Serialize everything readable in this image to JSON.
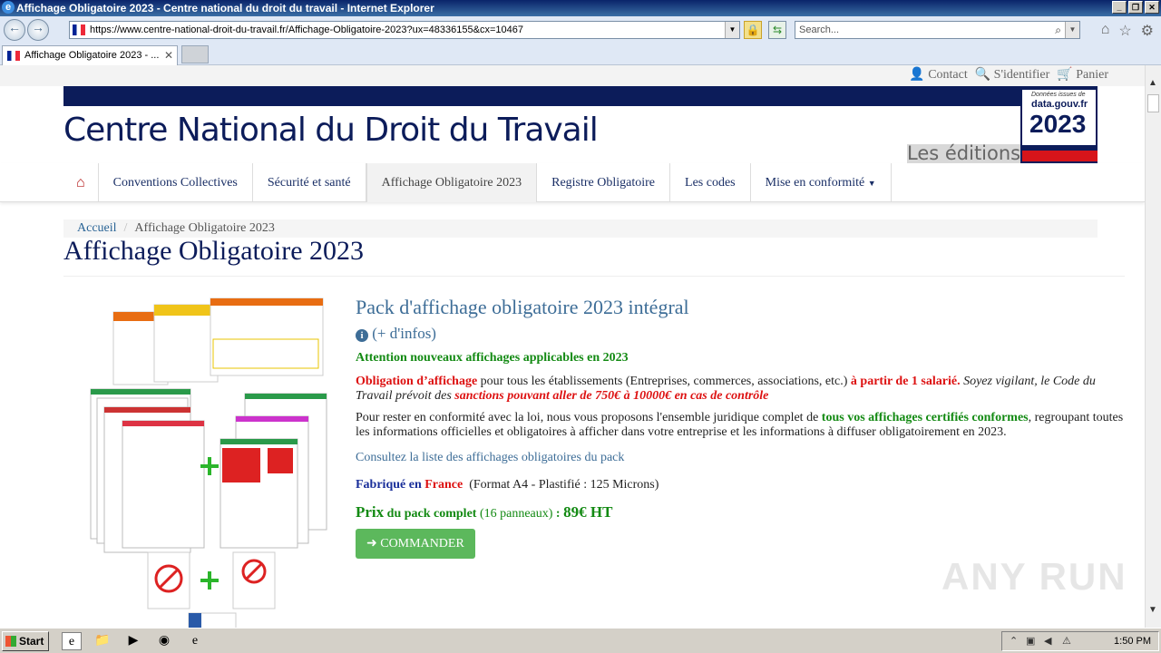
{
  "browser": {
    "window_title": "Affichage Obligatoire 2023 - Centre national du droit du travail - Internet Explorer",
    "url": "https://www.centre-national-droit-du-travail.fr/Affichage-Obligatoire-2023?ux=48336155&cx=10467",
    "search_placeholder": "Search...",
    "tab_title": "Affichage Obligatoire 2023 - ..."
  },
  "topbar": {
    "contact": "Contact",
    "login": "S'identifier",
    "cart": "Panier"
  },
  "banner": {
    "title": "Centre National du Droit du Travail",
    "subtitle": "Les éditions",
    "badge_small": "Données issues de",
    "badge_site": "data.gouv.fr",
    "badge_year": "2023"
  },
  "menu": {
    "items": [
      "Conventions Collectives",
      "Sécurité et santé",
      "Affichage Obligatoire 2023",
      "Registre Obligatoire",
      "Les codes",
      "Mise en conformité"
    ]
  },
  "breadcrumb": {
    "home": "Accueil",
    "separator": "/",
    "current": "Affichage Obligatoire 2023"
  },
  "page_title": "Affichage Obligatoire 2023",
  "product": {
    "title": "Pack d'affichage obligatoire 2023 intégral",
    "info_link": "(+ d'infos)",
    "attention": "Attention nouveaux affichages applicables en 2023",
    "p1_red1": "Obligation d’affichage",
    "p1_text1": " pour tous les établissements (Entreprises, commerces, associations, etc.) ",
    "p1_red2": "à partir de 1 salarié.",
    "p1_italic": " Soyez vigilant, le Code du Travail prévoit des ",
    "p1_red3": "sanctions pouvant aller de 750€ à 10000€ en cas de contrôle",
    "p2_text1": "Pour rester en conformité avec la loi, nous vous proposons l'ensemble juridique complet de ",
    "p2_green": "tous vos affichages certifiés conformes",
    "p2_text2": ", regroupant toutes les informations officielles et obligatoires à afficher dans votre entreprise et les informations à diffuser obligatoirement en 2023.",
    "list_link": "Consultez la liste des affichages obligatoires du pack",
    "fab_word": "Fabriqué",
    "fab_en": " en ",
    "fab_country": "France",
    "fab_details": "(Format A4 - Plastifié : 125 Microns)",
    "prix_word": "Prix",
    "prix_mid": " du pack complet ",
    "prix_panels": "(16 panneaux)",
    "prix_colon": " : ",
    "prix_value": "89€ HT",
    "order_button": "COMMANDER"
  },
  "watermark": "ANY RUN",
  "taskbar": {
    "start": "Start",
    "clock": "1:50 PM"
  },
  "colors": {
    "navy": "#0c1c5a",
    "link_blue": "#3d6d97",
    "green": "#138a13",
    "red": "#d11111",
    "button_green": "#5cb85c"
  }
}
